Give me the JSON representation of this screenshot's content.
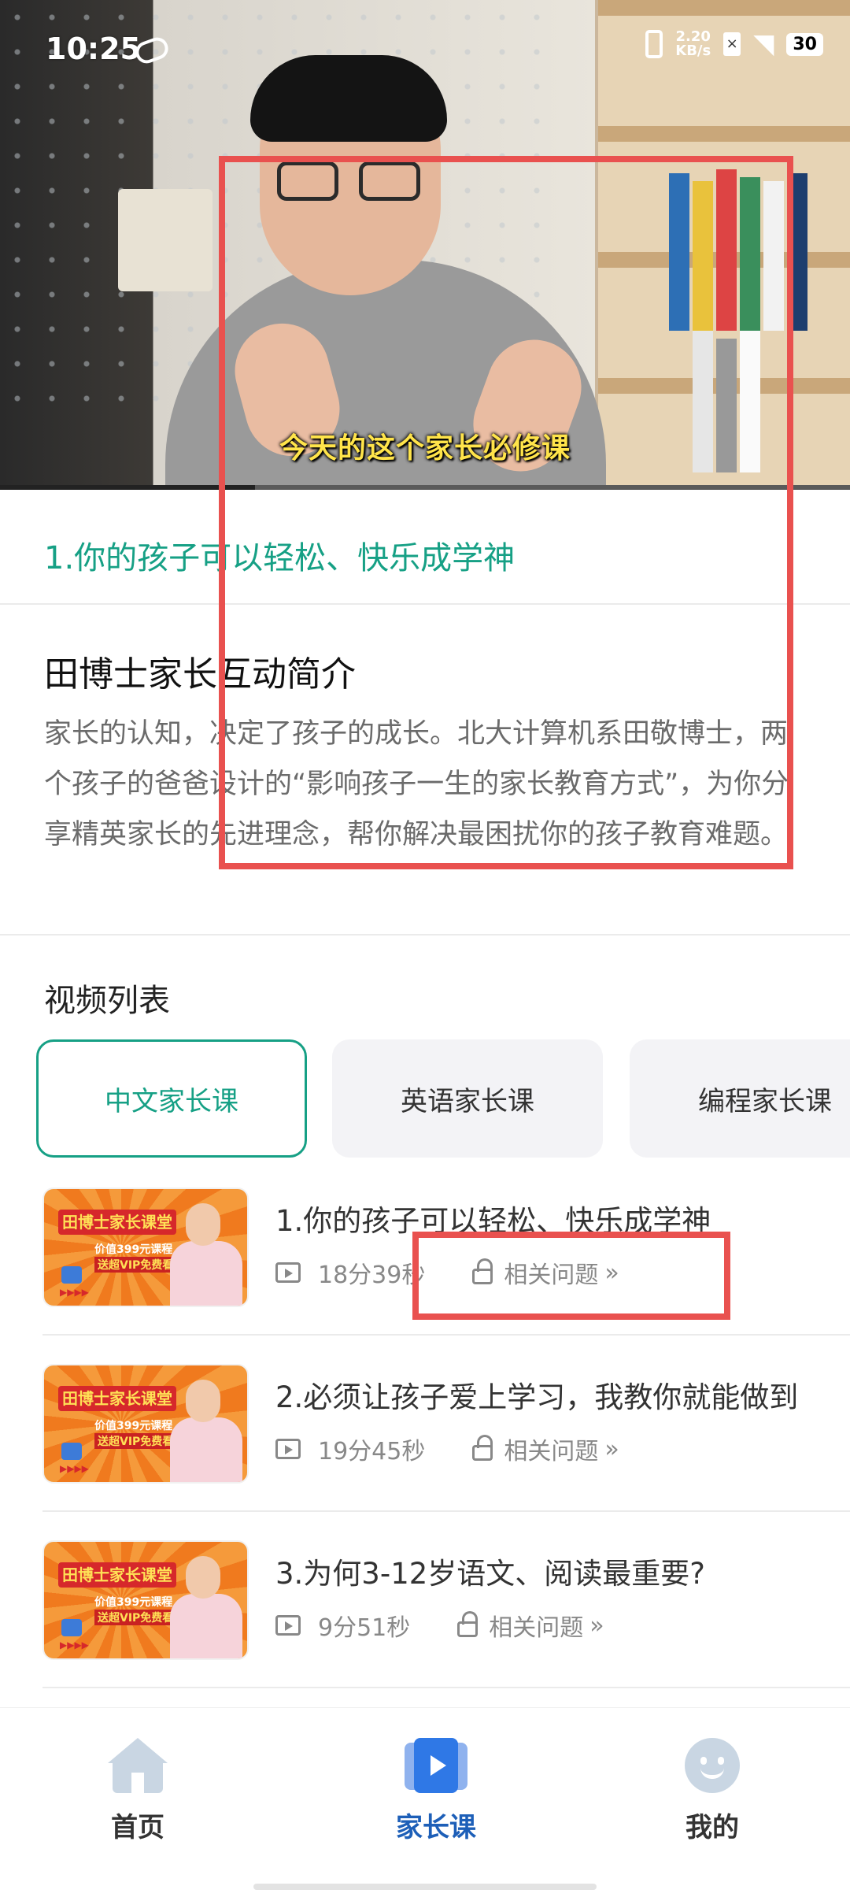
{
  "status_bar": {
    "time": "10:25",
    "net_speed_top": "2.20",
    "net_speed_bottom": "KB/s",
    "battery": "30"
  },
  "video": {
    "subtitle": "今天的这个家长必修课",
    "progress_fraction": 0.3
  },
  "current_lesson": {
    "title": "1.你的孩子可以轻松、快乐成学神"
  },
  "intro": {
    "title": "田博士家长互动简介",
    "description": "家长的认知，决定了孩子的成长。北大计算机系田敬博士，两个孩子的爸爸设计的“影响孩子一生的家长教育方式”，为你分享精英家长的先进理念，帮你解决最困扰你的孩子教育难题。"
  },
  "video_list": {
    "heading": "视频列表",
    "tabs": [
      {
        "label": "中文家长课"
      },
      {
        "label": "英语家长课"
      },
      {
        "label": "编程家长课"
      }
    ],
    "thumbnail": {
      "banner": "田博士家长课堂",
      "line1": "价值399元课程",
      "line2": "送超VIP免费看"
    },
    "items": [
      {
        "title": "1.你的孩子可以轻松、快乐成学神",
        "duration": "18分39秒",
        "related": "相关问题"
      },
      {
        "title": "2.必须让孩子爱上学习，我教你就能做到",
        "duration": "19分45秒",
        "related": "相关问题"
      },
      {
        "title": "3.为何3-12岁语文、阅读最重要?",
        "duration": "9分51秒",
        "related": "相关问题"
      }
    ]
  },
  "bottom_nav": {
    "items": [
      {
        "label": "首页",
        "icon": "home-icon"
      },
      {
        "label": "家长课",
        "icon": "video-course-icon"
      },
      {
        "label": "我的",
        "icon": "smiley-profile-icon"
      }
    ]
  },
  "colors": {
    "accent_green": "#16a085",
    "nav_active": "#1d5fb8",
    "annotation_red": "#e9514f"
  }
}
